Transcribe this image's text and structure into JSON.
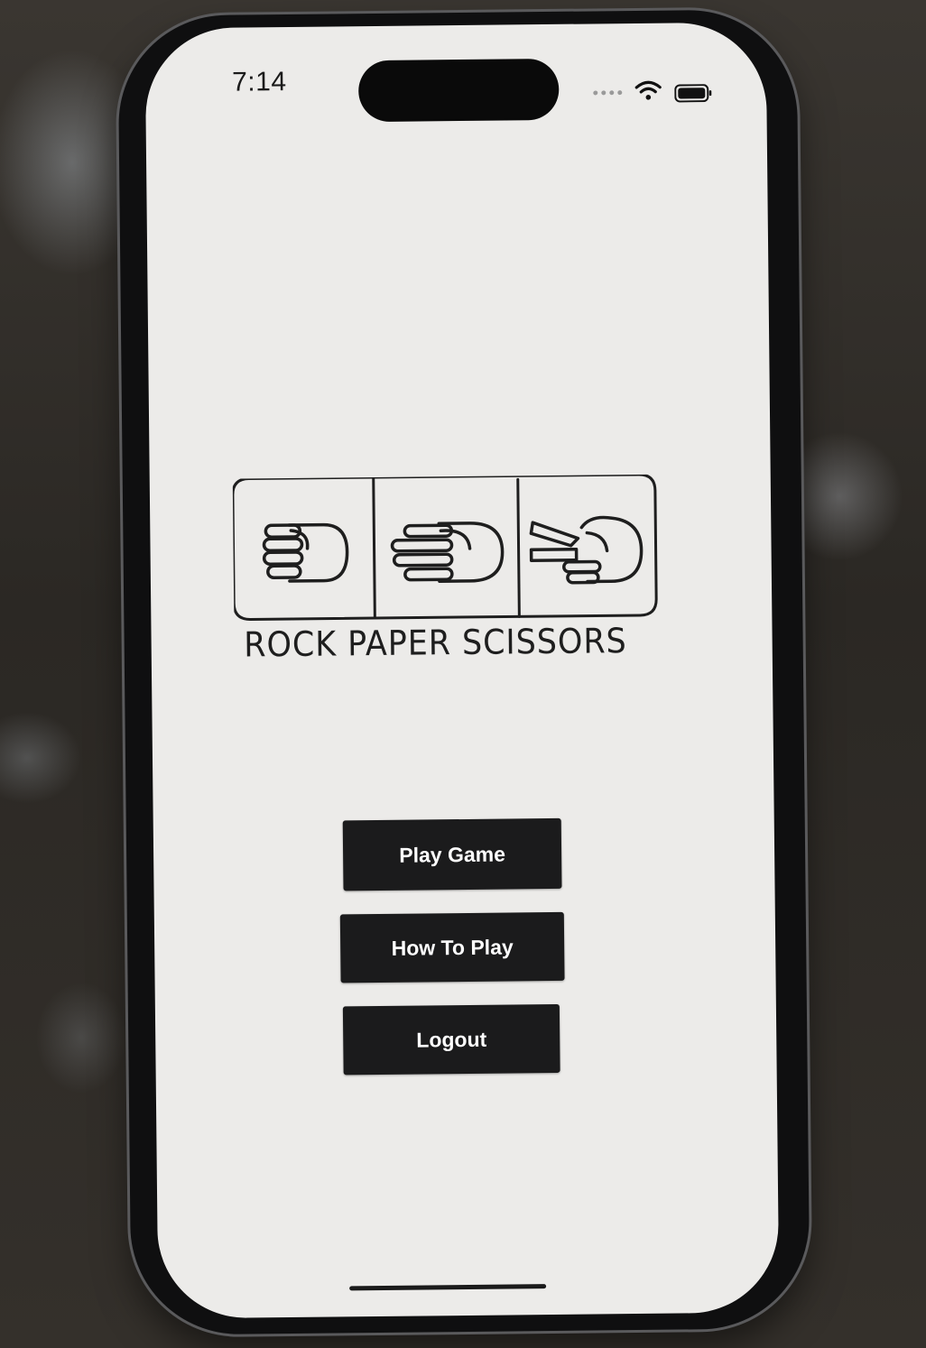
{
  "status_bar": {
    "time": "7:14",
    "icons": [
      "cellular-dots-icon",
      "wifi-icon",
      "battery-icon"
    ]
  },
  "logo": {
    "title": "ROCK PAPER SCISSORS",
    "panels": [
      "rock-hand-icon",
      "paper-hand-icon",
      "scissors-hand-icon"
    ]
  },
  "menu": {
    "play_label": "Play Game",
    "how_label": "How To Play",
    "logout_label": "Logout"
  },
  "colors": {
    "screen_background": "#ecebe9",
    "button_background": "#1b1b1c",
    "button_text": "#ffffff",
    "logo_stroke": "#1e1e1e"
  }
}
